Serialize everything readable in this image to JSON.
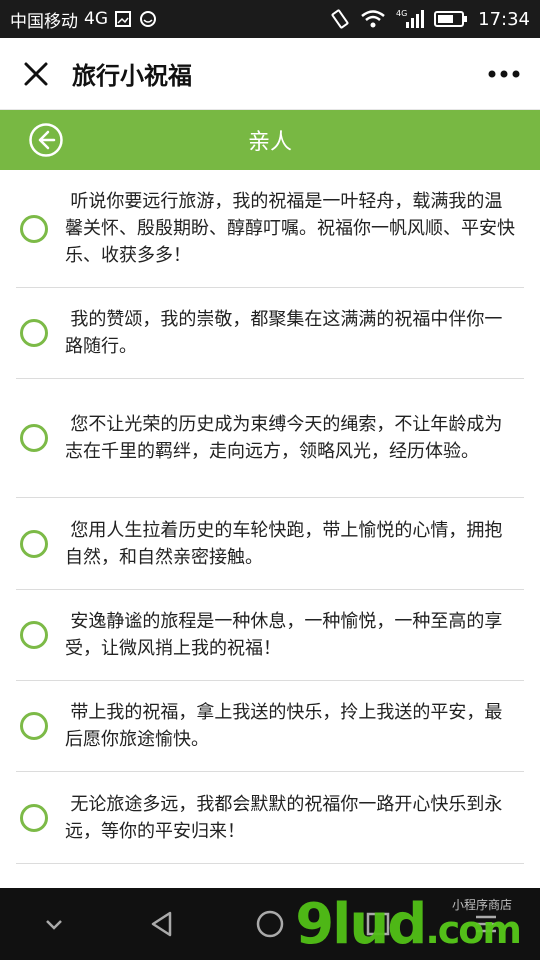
{
  "status_bar": {
    "carrier": "中国移动",
    "network": "4G",
    "time": "17:34"
  },
  "title_bar": {
    "title": "旅行小祝福",
    "close_icon": "close-icon",
    "more_icon": "more-icon"
  },
  "sub_header": {
    "title": "亲人",
    "back_icon": "back-circle-icon",
    "background": "#78b843"
  },
  "items": [
    {
      "text": "听说你要远行旅游，我的祝福是一叶轻舟，载满我的温馨关怀、殷殷期盼、醇醇叮嘱。祝福你一帆风顺、平安快乐、收获多多！"
    },
    {
      "text": "我的赞颂，我的崇敬，都聚集在这满满的祝福中伴你一路随行。"
    },
    {
      "text": "您不让光荣的历史成为束缚今天的绳索，不让年龄成为志在千里的羁绊，走向远方，领略风光，经历体验。"
    },
    {
      "text": "您用人生拉着历史的车轮快跑，带上愉悦的心情，拥抱自然，和自然亲密接触。"
    },
    {
      "text": "安逸静谧的旅程是一种休息，一种愉悦，一种至高的享受，让微风捎上我的祝福！"
    },
    {
      "text": "带上我的祝福，拿上我送的快乐，拎上我送的平安，最后愿你旅途愉快。"
    },
    {
      "text": "无论旅途多远，我都会默默的祝福你一路开心快乐到永远，等你的平安归来！"
    }
  ],
  "watermark": {
    "main": "9lud",
    "suffix": ".com",
    "sub": "小程序商店"
  }
}
